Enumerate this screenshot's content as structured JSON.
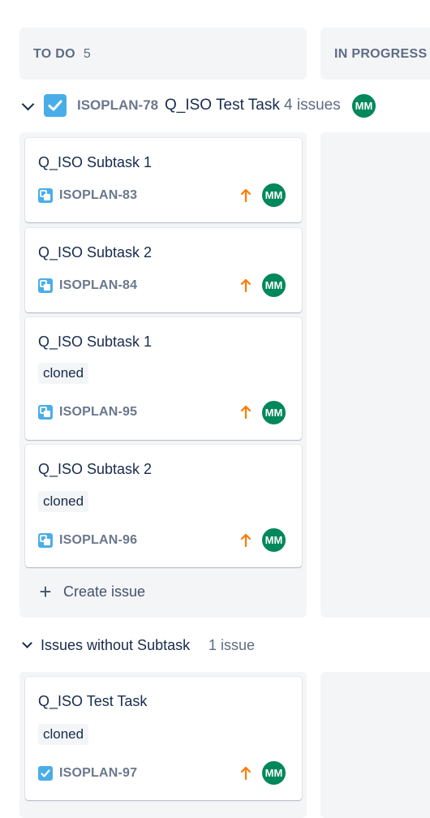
{
  "columns": [
    {
      "title": "TO DO",
      "count": "5"
    },
    {
      "title": "IN PROGRESS",
      "count": ""
    }
  ],
  "swimlane": {
    "key": "ISOPLAN-78",
    "name": "Q_ISO Test Task",
    "count": "4 issues",
    "avatar": "MM"
  },
  "cards": [
    {
      "title": "Q_ISO Subtask 1",
      "label": "",
      "key": "ISOPLAN-83",
      "avatar": "MM"
    },
    {
      "title": "Q_ISO Subtask 2",
      "label": "",
      "key": "ISOPLAN-84",
      "avatar": "MM"
    },
    {
      "title": "Q_ISO Subtask 1",
      "label": "cloned",
      "key": "ISOPLAN-95",
      "avatar": "MM"
    },
    {
      "title": "Q_ISO Subtask 2",
      "label": "cloned",
      "key": "ISOPLAN-96",
      "avatar": "MM"
    }
  ],
  "create_issue": "Create issue",
  "swimlane2": {
    "name": "Issues without Subtask",
    "count": "1 issue"
  },
  "card2": {
    "title": "Q_ISO Test Task",
    "label": "cloned",
    "key": "ISOPLAN-97",
    "avatar": "MM"
  },
  "colors": {
    "avatar": "#00875a",
    "priority": "#ff7a00",
    "subtask_icon": "#4bade8",
    "column_bg": "#f4f5f7"
  }
}
